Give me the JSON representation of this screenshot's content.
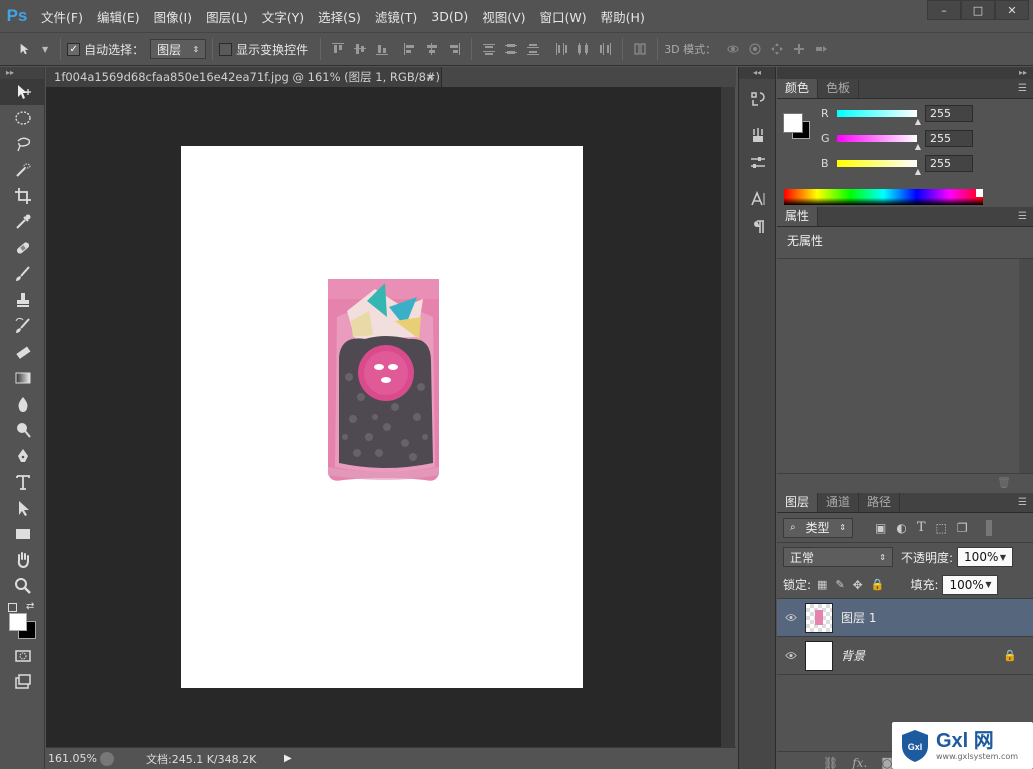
{
  "app": {
    "logo": "Ps"
  },
  "menu": [
    "文件(F)",
    "编辑(E)",
    "图像(I)",
    "图层(L)",
    "文字(Y)",
    "选择(S)",
    "滤镜(T)",
    "3D(D)",
    "视图(V)",
    "窗口(W)",
    "帮助(H)"
  ],
  "window_controls": [
    "–",
    "□",
    "✕"
  ],
  "options": {
    "auto_select_label": "自动选择：",
    "auto_select_value": "图层",
    "transform_controls_label": "显示变换控件",
    "mode_3d_label": "3D 模式："
  },
  "document": {
    "tab_title": "1f004a1569d68cfaa850e16e42ea71f.jpg @ 161% (图层 1, RGB/8#) *",
    "close": "×",
    "zoom": "161.05%",
    "doc_info": "文档:245.1 K/348.2K"
  },
  "color_panel": {
    "tabs": [
      "颜色",
      "色板"
    ],
    "channels": [
      {
        "label": "R",
        "value": "255"
      },
      {
        "label": "G",
        "value": "255"
      },
      {
        "label": "B",
        "value": "255"
      }
    ]
  },
  "properties_panel": {
    "tabs": [
      "属性"
    ],
    "content": "无属性"
  },
  "layers_panel": {
    "tabs": [
      "图层",
      "通道",
      "路径"
    ],
    "filter_label": "类型",
    "blend_mode": "正常",
    "opacity_label": "不透明度:",
    "opacity_value": "100%",
    "lock_label": "锁定:",
    "fill_label": "填充:",
    "fill_value": "100%",
    "layers": [
      {
        "name": "图层 1",
        "selected": true
      },
      {
        "name": "背景",
        "locked": true
      }
    ]
  },
  "watermark": {
    "brand": "Gxl 网",
    "url": "www.gxlsystem.com"
  },
  "colors": {
    "ps_blue": "#3ea6e8",
    "panel": "#535353",
    "canvas_bg": "#282828",
    "selected_layer": "#56667c"
  }
}
